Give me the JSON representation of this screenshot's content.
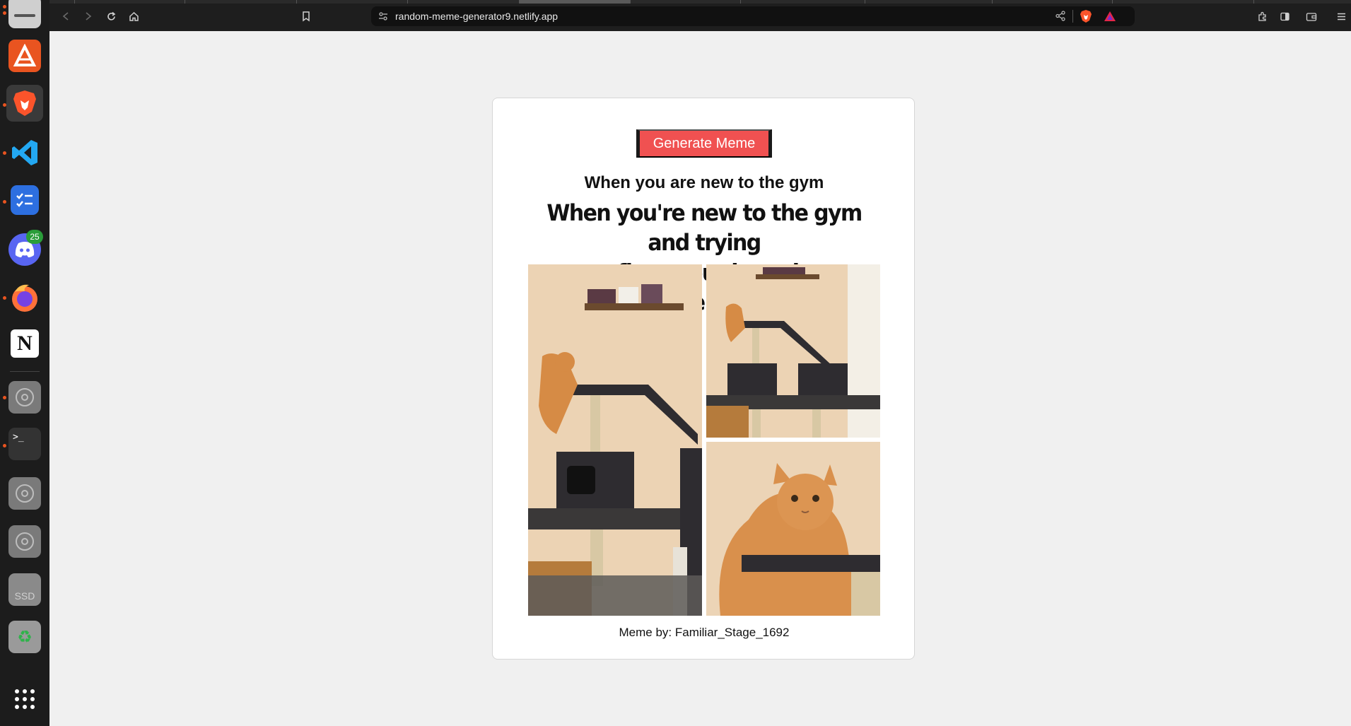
{
  "browser": {
    "url": "random-meme-generator9.netlify.app"
  },
  "dock": {
    "badge_count": "25",
    "ssd_label": "SSD",
    "items": [
      {
        "name": "files"
      },
      {
        "name": "app-center"
      },
      {
        "name": "brave-browser"
      },
      {
        "name": "vscode"
      },
      {
        "name": "tasks"
      },
      {
        "name": "discord"
      },
      {
        "name": "firefox"
      },
      {
        "name": "notion"
      },
      {
        "name": "disc"
      },
      {
        "name": "terminal"
      },
      {
        "name": "disc-2"
      },
      {
        "name": "disc-3"
      },
      {
        "name": "ssd-drive"
      },
      {
        "name": "trash"
      },
      {
        "name": "app-grid"
      }
    ]
  },
  "app": {
    "generate_button": "Generate Meme",
    "meme_title": "When you are new to the gym",
    "meme_caption_line1": "When you're new to the gym and trying",
    "meme_caption_line2": "to figure out how the equipment works",
    "author_line": "Meme by: Familiar_Stage_1692"
  },
  "colors": {
    "button_bg": "#f05151",
    "page_bg": "#f0f0f0",
    "dock_bg": "#1c1c1c",
    "browser_bar": "#1e1e1e"
  }
}
